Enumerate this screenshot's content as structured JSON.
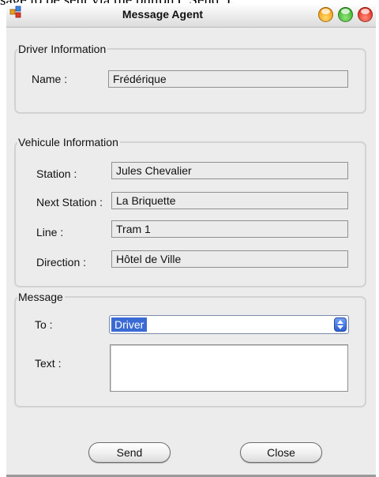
{
  "caption_text": "sage to be sent via the button (\"Send\").",
  "window": {
    "title": "Message Agent"
  },
  "driver_info": {
    "legend": "Driver Information",
    "name_label": "Name :",
    "name_value": "Frédérique"
  },
  "vehicle_info": {
    "legend": "Vehicule Information",
    "station_label": "Station :",
    "station_value": "Jules Chevalier",
    "next_station_label": "Next Station :",
    "next_station_value": "La Briquette",
    "line_label": "Line :",
    "line_value": "Tram 1",
    "direction_label": "Direction :",
    "direction_value": "Hôtel de Ville"
  },
  "message": {
    "legend": "Message",
    "to_label": "To :",
    "to_value": "Driver",
    "text_label": "Text :",
    "text_value": ""
  },
  "buttons": {
    "send": "Send",
    "close": "Close"
  },
  "colors": {
    "selection": "#3a6ad4",
    "window_bg": "#ececec"
  }
}
